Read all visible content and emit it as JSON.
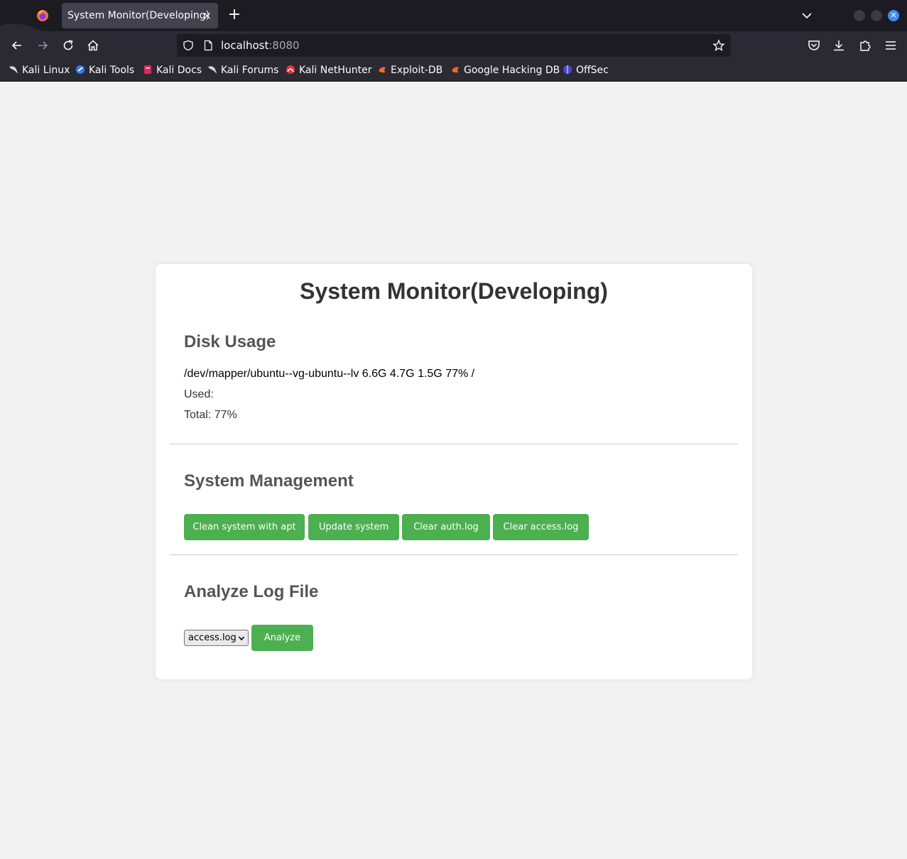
{
  "browser": {
    "tab_title": "System Monitor(Developing)",
    "tab_close": "×",
    "new_tab": "+",
    "url_host": "localhost",
    "url_port": ":8080",
    "bookmarks": [
      {
        "label": "Kali Linux",
        "icon": "kali-dragon-icon"
      },
      {
        "label": "Kali Tools",
        "icon": "kali-tools-icon"
      },
      {
        "label": "Kali Docs",
        "icon": "kali-docs-icon"
      },
      {
        "label": "Kali Forums",
        "icon": "kali-dragon-icon"
      },
      {
        "label": "Kali NetHunter",
        "icon": "nethunter-icon"
      },
      {
        "label": "Exploit-DB",
        "icon": "exploit-db-icon"
      },
      {
        "label": "Google Hacking DB",
        "icon": "exploit-db-icon"
      },
      {
        "label": "OffSec",
        "icon": "offsec-icon"
      }
    ]
  },
  "page": {
    "title": "System Monitor(Developing)",
    "disk": {
      "heading": "Disk Usage",
      "line": "/dev/mapper/ubuntu--vg-ubuntu--lv 6.6G 4.7G 1.5G 77% /",
      "used": "Used:",
      "total": "Total: 77%"
    },
    "management": {
      "heading": "System Management",
      "buttons": [
        "Clean system with apt",
        "Update system",
        "Clear auth.log",
        "Clear access.log"
      ]
    },
    "analyze": {
      "heading": "Analyze Log File",
      "selected": "access.log",
      "button": "Analyze"
    }
  },
  "colors": {
    "accent": "#4caf50",
    "page_bg": "#f2f2f2",
    "card_bg": "#ffffff",
    "title": "#333333",
    "heading": "#555555"
  }
}
